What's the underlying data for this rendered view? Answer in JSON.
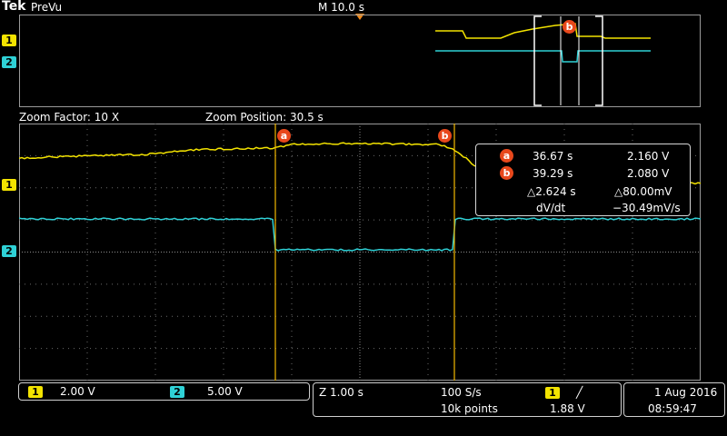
{
  "brand": "Tek",
  "mode": "PreVu",
  "timebase_label": "M 10.0 s",
  "zoom": {
    "factor_text": "Zoom Factor: 10 X",
    "position_text": "Zoom Position: 30.5 s"
  },
  "channels": {
    "ch1": {
      "label": "1",
      "scale": "2.00 V",
      "color": "#f3e300"
    },
    "ch2": {
      "label": "2",
      "scale": "5.00 V",
      "color": "#2fd1d6"
    }
  },
  "cursors": {
    "a": {
      "label": "a",
      "time": "36.67 s",
      "volts": "2.160 V"
    },
    "b": {
      "label": "b",
      "time": "39.29 s",
      "volts": "2.080 V"
    },
    "delta_t": "△2.624 s",
    "delta_v": "△80.00mV",
    "dvdt_label": "dV/dt",
    "dvdt_value": "−30.49mV/s",
    "color": "#e8481c"
  },
  "status": {
    "zoom_time": "Z 1.00 s",
    "sample_rate": "100 S/s",
    "record_length": "10k points",
    "trigger_source": "1",
    "trigger_slope": "╱",
    "trigger_level": "1.88 V",
    "date": "1 Aug 2016",
    "time": "08:59:47"
  }
}
